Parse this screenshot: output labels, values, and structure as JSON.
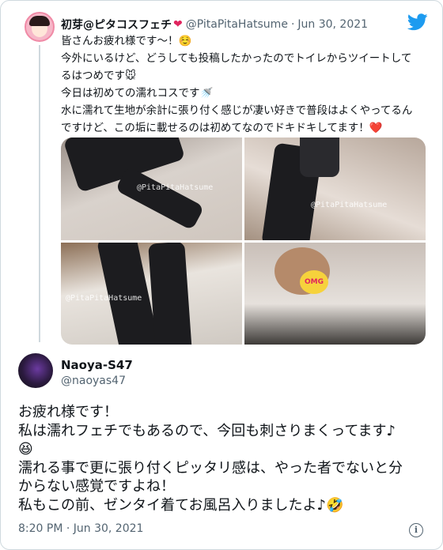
{
  "quoted_tweet": {
    "author_name": "初芽@ピタコスフェチ",
    "name_icon": "red-heart",
    "handle": "@PitaPitaHatsume",
    "separator": "·",
    "date": "Jun 30, 2021",
    "lines": [
      "皆さんお疲れ様です～！☺️",
      "今外にいるけど、どうしても投稿したかったのでトイレからツイートして",
      "るはつめです🐭",
      "今日は初めての濡れコスです🚿",
      "水に濡れて生地が余計に張り付く感じが凄い好きで普段はよくやってるん",
      "ですけど、この垢に載せるのは初めてなのでドキドキしてます！❤️"
    ],
    "media": {
      "watermark_1": "@PitaPitaHatsume",
      "watermark_2": "@PitaPitaHatsume",
      "watermark_3": "@PitaPitaHatsume",
      "badge": "OMG"
    }
  },
  "reply_tweet": {
    "author_name": "Naoya-S47",
    "handle": "@naoyas47",
    "lines": [
      "お疲れ様です！",
      "私は濡れフェチでもあるので、今回も刺さりまくってます♪",
      "😆",
      "濡れる事で更に張り付くピッタリ感は、やった者でないと分",
      "からない感覚ですよね！",
      "私もこの前、ゼンタイ着てお風呂入りましたよ♪🤣"
    ],
    "timestamp": "8:20 PM · Jun 30, 2021",
    "info_glyph": "i"
  },
  "colors": {
    "brand": "#1d9bf0",
    "text": "#0f1419",
    "secondary": "#536471",
    "heart": "#e0245e",
    "border": "#cfd9de"
  }
}
